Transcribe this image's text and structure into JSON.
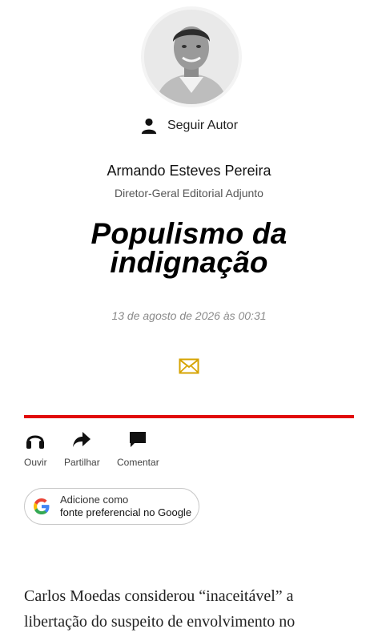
{
  "author": {
    "follow_label": "Seguir Autor",
    "name": "Armando Esteves Pereira",
    "role": "Diretor-Geral Editorial Adjunto"
  },
  "article": {
    "title_line1": "Populismo da",
    "title_line2": "indignação",
    "date": "13 de agosto de 2026 às 00:31",
    "body_line1": "Carlos Moedas considerou “inaceitável” a",
    "body_line2": "libertação do suspeito de envolvimento no"
  },
  "actions": {
    "listen": "Ouvir",
    "share": "Partilhar",
    "comment": "Comentar"
  },
  "google": {
    "line1": "Adicione como",
    "line2": "fonte preferencial no Google"
  },
  "colors": {
    "accent_red": "#e10a0a",
    "mail_icon": "#d6a300"
  },
  "icons": [
    "avatar",
    "user-icon",
    "mail-icon",
    "headphones-icon",
    "share-icon",
    "comment-icon",
    "google-logo-icon"
  ]
}
